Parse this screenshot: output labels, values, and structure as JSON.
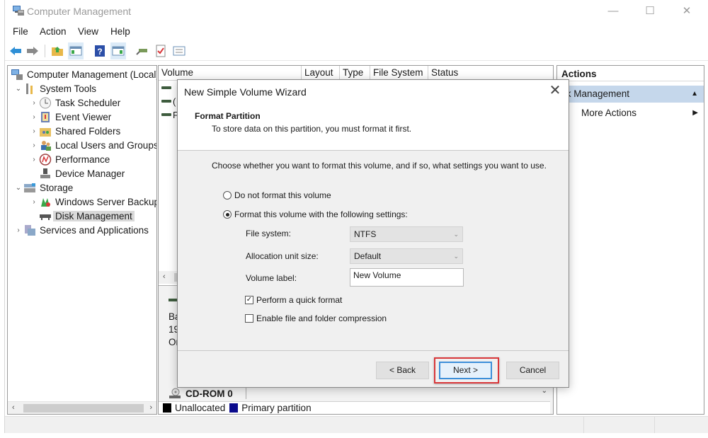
{
  "window": {
    "title": "Computer Management",
    "controls": {
      "minimize": "—",
      "maximize": "☐",
      "close": "✕"
    }
  },
  "menubar": [
    "File",
    "Action",
    "View",
    "Help"
  ],
  "toolbar": {
    "icons": [
      "back-icon",
      "forward-icon",
      "up-folder-icon",
      "show-hide-console-tree-icon",
      "help-icon",
      "show-hide-action-pane-icon",
      "connect-icon",
      "check-icon",
      "properties-icon"
    ]
  },
  "tree": {
    "root": "Computer Management (Local)",
    "items": [
      {
        "label": "System Tools",
        "level": 1,
        "expander": "expanded"
      },
      {
        "label": "Task Scheduler",
        "level": 2,
        "expander": "collapsed"
      },
      {
        "label": "Event Viewer",
        "level": 2,
        "expander": "collapsed"
      },
      {
        "label": "Shared Folders",
        "level": 2,
        "expander": "collapsed"
      },
      {
        "label": "Local Users and Groups",
        "level": 2,
        "expander": "collapsed"
      },
      {
        "label": "Performance",
        "level": 2,
        "expander": "collapsed"
      },
      {
        "label": "Device Manager",
        "level": 2,
        "expander": "none"
      },
      {
        "label": "Storage",
        "level": 1,
        "expander": "expanded"
      },
      {
        "label": "Windows Server Backup",
        "level": 2,
        "expander": "collapsed"
      },
      {
        "label": "Disk Management",
        "level": 2,
        "expander": "none",
        "selected": true
      },
      {
        "label": "Services and Applications",
        "level": 1,
        "expander": "collapsed"
      }
    ]
  },
  "volume_list": {
    "columns": [
      "Volume",
      "Layout",
      "Type",
      "File System",
      "Status"
    ],
    "rows_partial": [
      "",
      "(",
      "F"
    ]
  },
  "disk_view": {
    "partial_text": [
      "Bas",
      "19",
      "On"
    ],
    "cdrom_label": "CD-ROM 0",
    "legend": [
      {
        "label": "Unallocated",
        "color": "#000000"
      },
      {
        "label": "Primary partition",
        "color": "#0a0a8c"
      }
    ]
  },
  "actions": {
    "header": "Actions",
    "section": "sk Management",
    "items": [
      {
        "label": "More Actions"
      }
    ]
  },
  "wizard": {
    "title": "New Simple Volume Wizard",
    "heading": "Format Partition",
    "subheading": "To store data on this partition, you must format it first.",
    "instruction": "Choose whether you want to format this volume, and if so, what settings you want to use.",
    "options": [
      {
        "label": "Do not format this volume",
        "checked": false
      },
      {
        "label": "Format this volume with the following settings:",
        "checked": true
      }
    ],
    "fields": {
      "file_system": {
        "label": "File system:",
        "value": "NTFS"
      },
      "allocation_unit": {
        "label": "Allocation unit size:",
        "value": "Default"
      },
      "volume_label": {
        "label": "Volume label:",
        "value": "New Volume"
      }
    },
    "checkboxes": [
      {
        "label": "Perform a quick format",
        "checked": true
      },
      {
        "label": "Enable file and folder compression",
        "checked": false
      }
    ],
    "buttons": {
      "back": "< Back",
      "next": "Next >",
      "cancel": "Cancel"
    },
    "highlight_color": "#d9373a"
  }
}
